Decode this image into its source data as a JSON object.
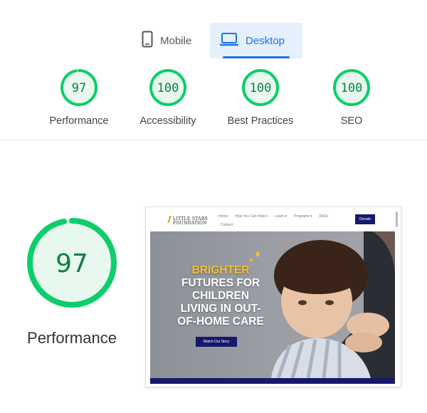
{
  "tabs": [
    {
      "label": "Mobile",
      "icon": "smartphone-icon",
      "active": false
    },
    {
      "label": "Desktop",
      "icon": "laptop-icon",
      "active": true
    }
  ],
  "scores": [
    {
      "label": "Performance",
      "value": "97",
      "fraction": 0.97
    },
    {
      "label": "Accessibility",
      "value": "100",
      "fraction": 1.0
    },
    {
      "label": "Best Practices",
      "value": "100",
      "fraction": 1.0
    },
    {
      "label": "SEO",
      "value": "100",
      "fraction": 1.0
    }
  ],
  "main": {
    "score": "97",
    "fraction": 0.97,
    "label": "Performance"
  },
  "colors": {
    "pass": "#0cce6b",
    "pass_text": "#0b8043",
    "pass_bg": "#e8f8ef",
    "accent": "#1a73e8",
    "navy": "#15186b",
    "gold": "#f6c02c"
  },
  "preview": {
    "logo_line1": "LITTLE STARS",
    "logo_line2": "FOUNDATION",
    "nav": [
      "Home",
      "How You Can Help ▾",
      "Learn ▾",
      "Programs ▾",
      "FAQs"
    ],
    "nav_second": "Contact",
    "donate": "Donate",
    "hero_accent": "BRIGHTER",
    "hero_lines": [
      "FUTURES FOR",
      "CHILDREN",
      "LIVING IN OUT-",
      "OF-HOME CARE"
    ],
    "cta": "Watch Our Story"
  }
}
